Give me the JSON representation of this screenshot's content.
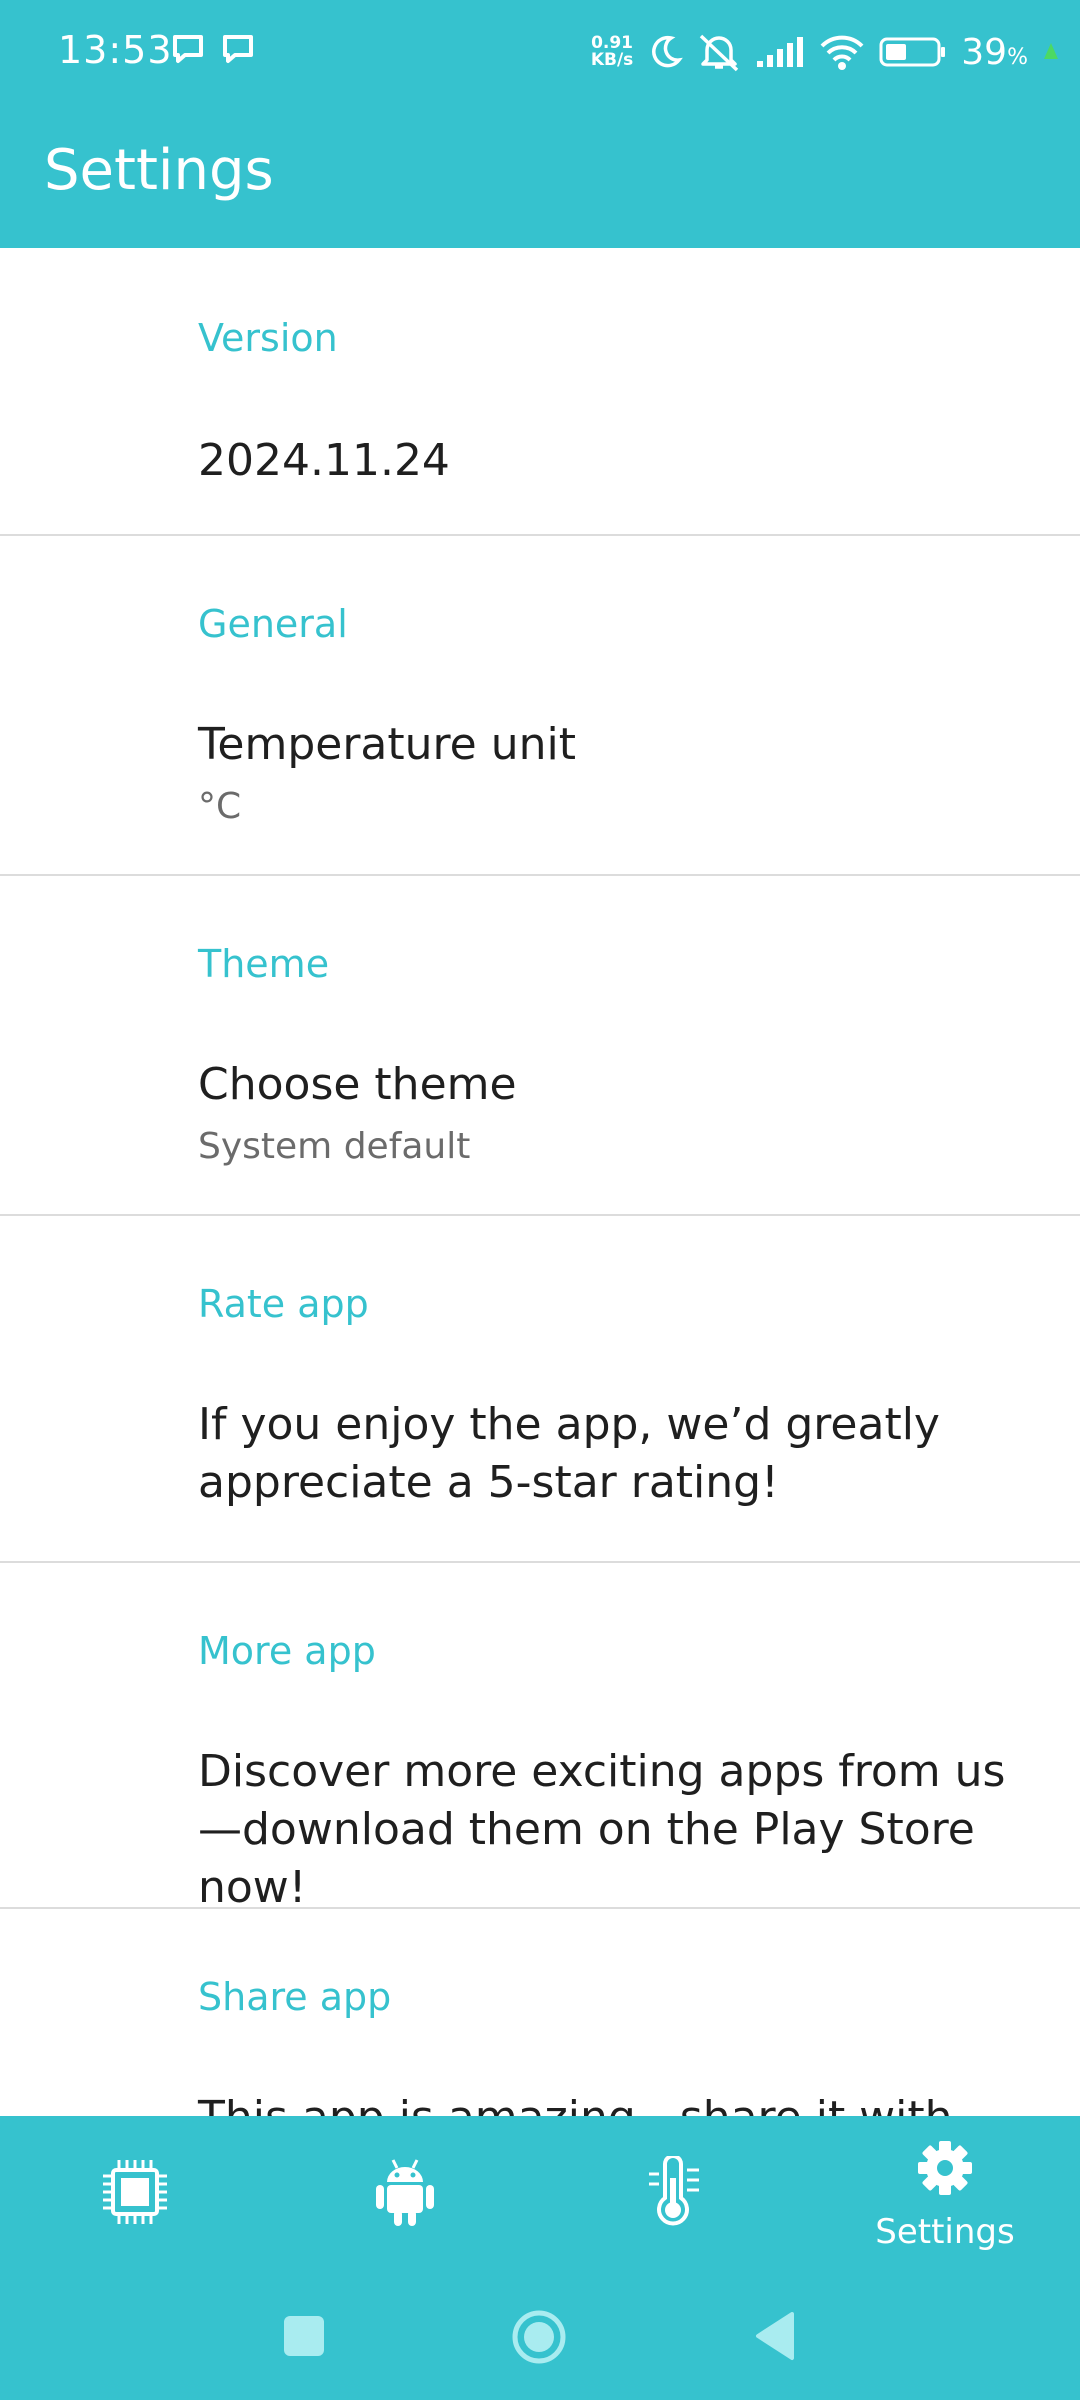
{
  "status_bar": {
    "time": "13:53",
    "net_speed_value": "0.91",
    "net_speed_unit": "KB/s",
    "battery_percent": "39",
    "battery_suffix": "%"
  },
  "app_bar": {
    "title": "Settings"
  },
  "sections": [
    {
      "header": "Version",
      "title": "2024.11.24",
      "subtitle": ""
    },
    {
      "header": "General",
      "title": "Temperature unit",
      "subtitle": "°C"
    },
    {
      "header": "Theme",
      "title": "Choose theme",
      "subtitle": "System default"
    },
    {
      "header": "Rate app",
      "title": "If you enjoy the app, we’d greatly appreciate a 5-star rating!",
      "subtitle": ""
    },
    {
      "header": "More app",
      "title": "Discover more exciting apps from us—download them on the Play Store now!",
      "subtitle": ""
    },
    {
      "header": "Share app",
      "title": "This app is amazing—share it with",
      "subtitle": ""
    }
  ],
  "bottom_nav": {
    "items": [
      {
        "icon": "cpu-chip-icon",
        "label": ""
      },
      {
        "icon": "android-icon",
        "label": ""
      },
      {
        "icon": "thermometer-icon",
        "label": ""
      },
      {
        "icon": "gear-icon",
        "label": "Settings",
        "active": true
      }
    ]
  },
  "colors": {
    "accent": "#36C2CE",
    "text": "#1f1f1f",
    "subtext": "#6b6b6b",
    "divider": "#dcdcdc"
  }
}
